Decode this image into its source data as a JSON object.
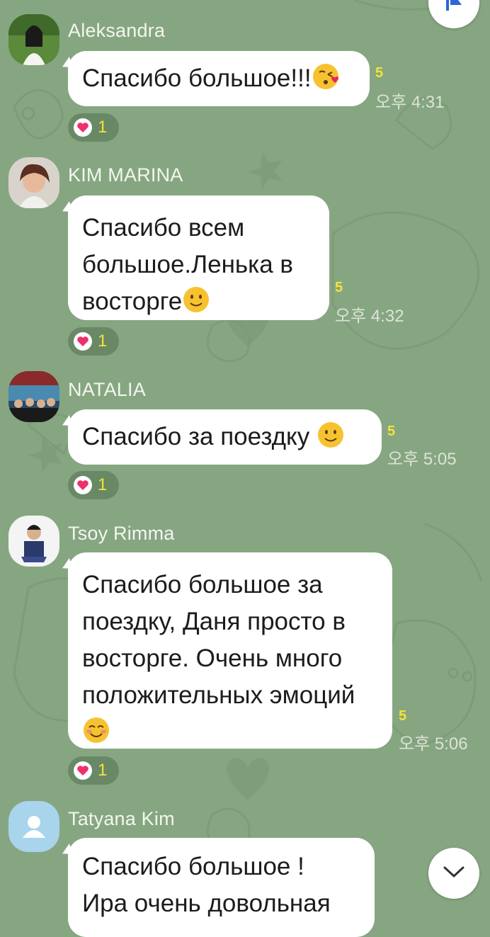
{
  "messages": [
    {
      "sender": "Aleksandra",
      "text": "Спасибо большое!!!",
      "emoji": "kiss-face",
      "unread": "5",
      "time": "오후 4:31",
      "reaction_count": "1"
    },
    {
      "sender": "KIM MARINA",
      "text": "Спасибо всем\nбольшое.Ленька в\nвосторге",
      "emoji": "slight-smile",
      "unread": "5",
      "time": "오후 4:32",
      "reaction_count": "1"
    },
    {
      "sender": "NATALIA",
      "text": "Спасибо за поездку ",
      "emoji": "slight-smile",
      "unread": "5",
      "time": "오후 5:05",
      "reaction_count": "1"
    },
    {
      "sender": "Tsoy Rimma",
      "text": "Спасибо большое за\nпоездку, Даня просто в\nвосторге. Очень много\nположительных эмоций\n",
      "emoji": "blush-smile",
      "unread": "5",
      "time": "오후 5:06",
      "reaction_count": "1"
    },
    {
      "sender": "Tatyana Kim",
      "text": "Спасибо большое  !\nИра очень довольная"
    }
  ],
  "icons": {
    "top_right": "flag-icon",
    "scroll_down": "chevron-down-icon",
    "reaction": "heart-icon",
    "default_avatar": "person-icon"
  },
  "colors": {
    "background": "#86a681",
    "bubble": "#ffffff",
    "unread": "#f4e23a",
    "heart": "#f0306a",
    "flag": "#2a66d8"
  }
}
